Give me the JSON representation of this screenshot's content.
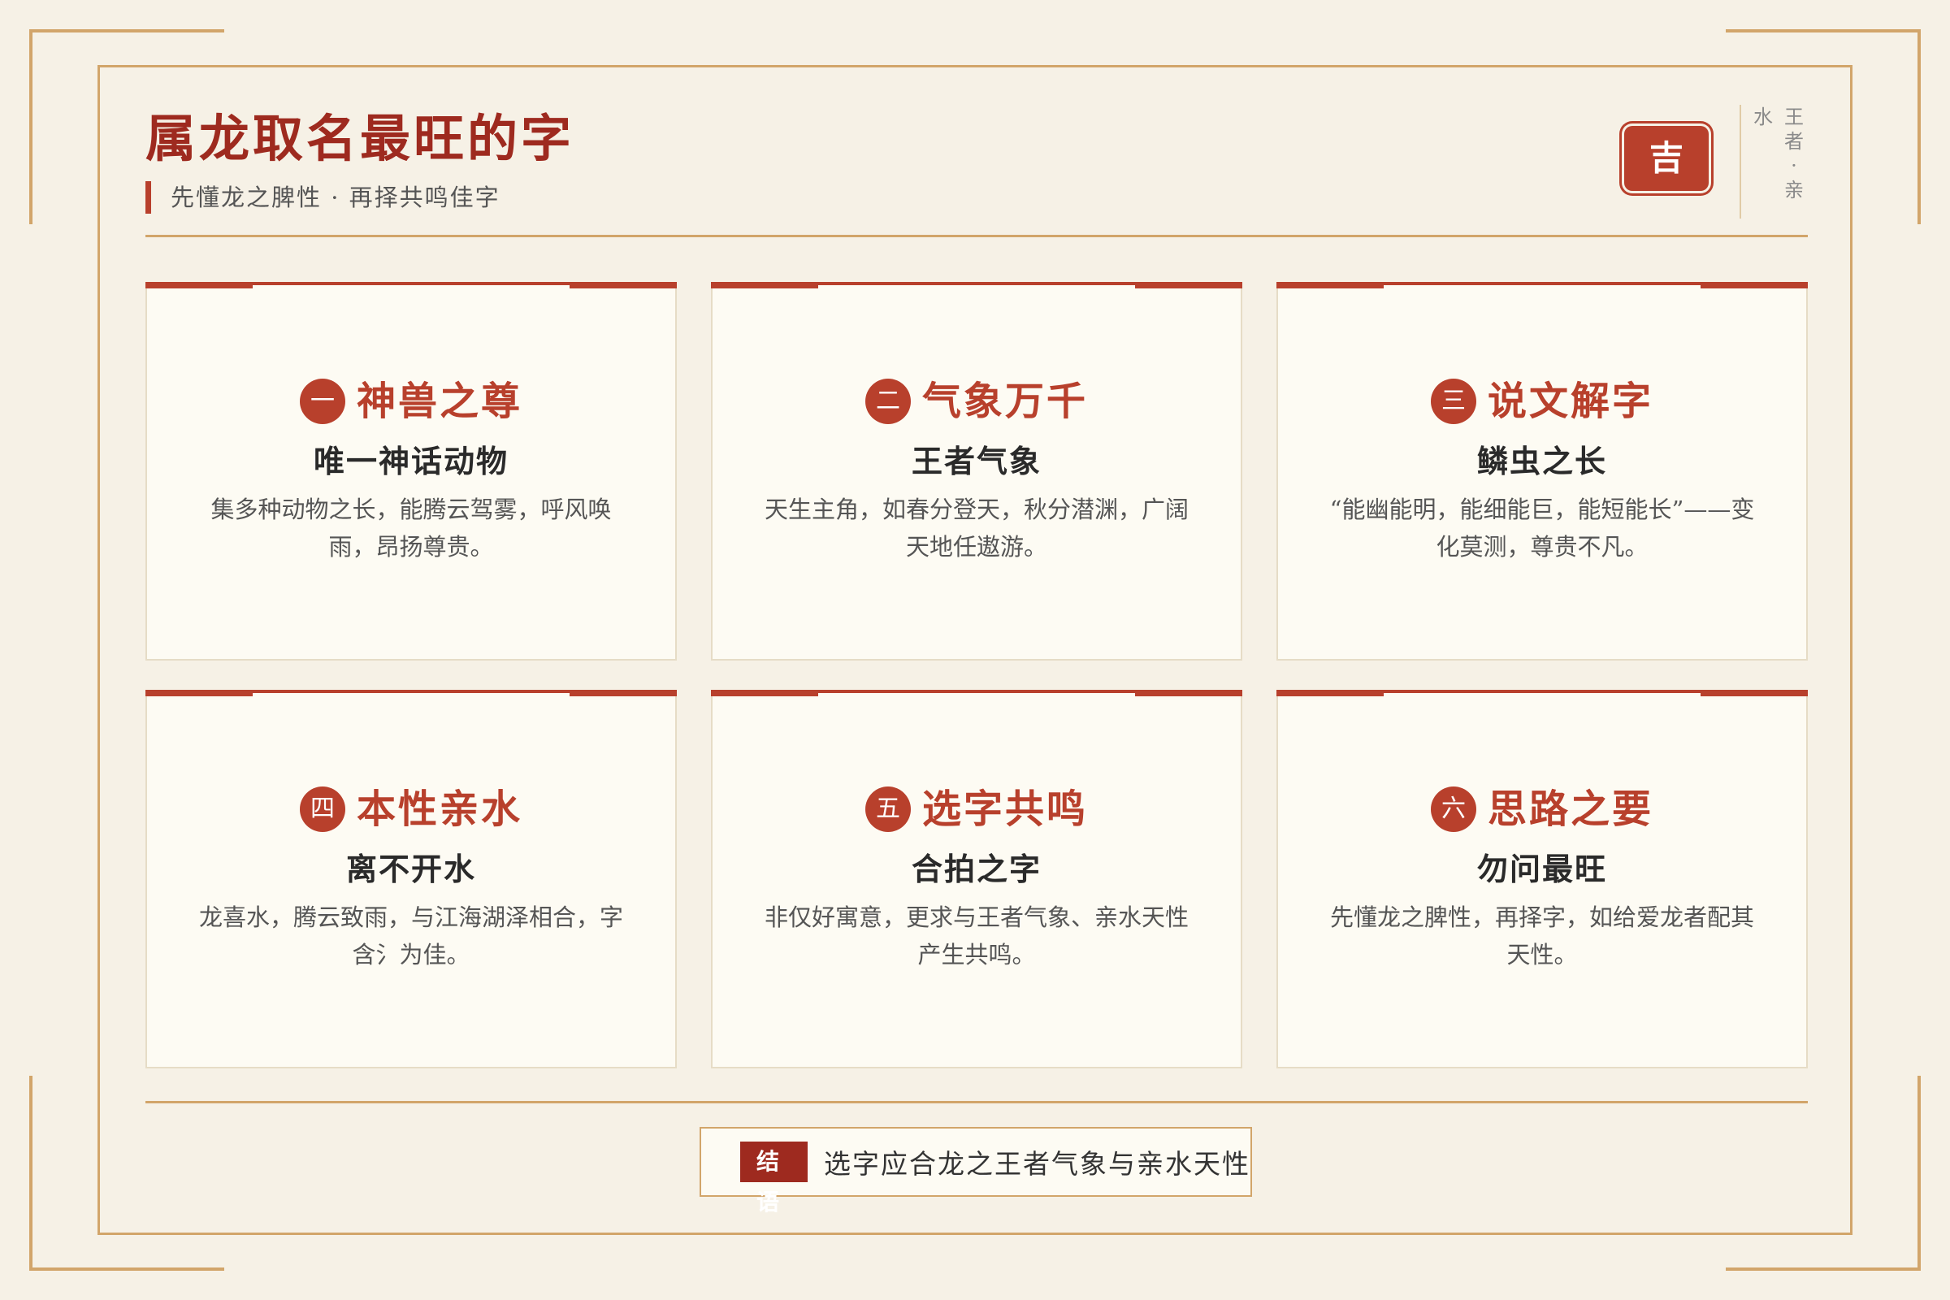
{
  "header": {
    "title": "属龙取名最旺的字",
    "subtitle": "先懂龙之脾性 · 再择共鸣佳字",
    "seal": "吉",
    "vertical_col1": [
      "王",
      "者",
      "·",
      "亲"
    ],
    "vertical_col2": [
      "水"
    ]
  },
  "cards": [
    {
      "num": "一",
      "title": "神兽之尊",
      "sub": "唯一神话动物",
      "desc": "集多种动物之长，能腾云驾雾，呼风唤雨，昂扬尊贵。"
    },
    {
      "num": "二",
      "title": "气象万千",
      "sub": "王者气象",
      "desc": "天生主角，如春分登天，秋分潜渊，广阔天地任遨游。"
    },
    {
      "num": "三",
      "title": "说文解字",
      "sub": "鳞虫之长",
      "desc": "“能幽能明，能细能巨，能短能长”——变化莫测，尊贵不凡。"
    },
    {
      "num": "四",
      "title": "本性亲水",
      "sub": "离不开水",
      "desc": "龙喜水，腾云致雨，与江海湖泽相合，字含氵为佳。"
    },
    {
      "num": "五",
      "title": "选字共鸣",
      "sub": "合拍之字",
      "desc": "非仅好寓意，更求与王者气象、亲水天性产生共鸣。"
    },
    {
      "num": "六",
      "title": "思路之要",
      "sub": "勿问最旺",
      "desc": "先懂龙之脾性，再择字，如给爱龙者配其天性。"
    }
  ],
  "conclusion": {
    "tag": "结语",
    "text": "选字应合龙之王者气象与亲水天性"
  },
  "colors": {
    "accent": "#b8402c",
    "title": "#9e2a1f",
    "gold": "#d2a56a",
    "background": "#f6f1e6"
  }
}
